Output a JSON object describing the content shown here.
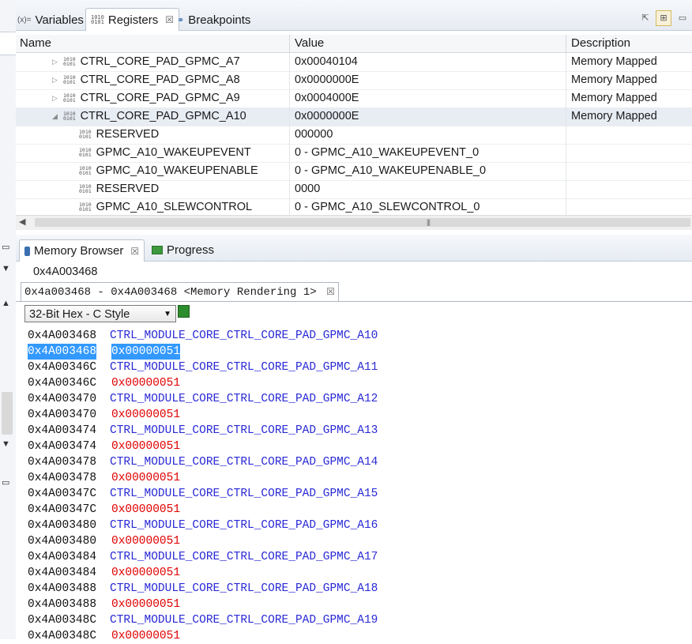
{
  "top_tabs": [
    {
      "label": "Variables",
      "icon": "(x)="
    },
    {
      "label": "Registers",
      "icon": "1010\n0101"
    },
    {
      "label": "Breakpoints",
      "icon": "oo"
    }
  ],
  "registers": {
    "columns": [
      "Name",
      "Value",
      "Description"
    ],
    "rows": [
      {
        "name": "CTRL_CORE_PAD_GPMC_A7",
        "value": "0x00040104",
        "desc": "Memory Mapped",
        "expanded": false
      },
      {
        "name": "CTRL_CORE_PAD_GPMC_A8",
        "value": "0x0000000E",
        "desc": "Memory Mapped",
        "expanded": false
      },
      {
        "name": "CTRL_CORE_PAD_GPMC_A9",
        "value": "0x0004000E",
        "desc": "Memory Mapped",
        "expanded": false
      },
      {
        "name": "CTRL_CORE_PAD_GPMC_A10",
        "value": "0x0000000E",
        "desc": "Memory Mapped",
        "expanded": true
      },
      {
        "name": "RESERVED",
        "value": "000000",
        "desc": ""
      },
      {
        "name": "GPMC_A10_WAKEUPEVENT",
        "value": "0 - GPMC_A10_WAKEUPEVENT_0",
        "desc": ""
      },
      {
        "name": "GPMC_A10_WAKEUPENABLE",
        "value": "0 - GPMC_A10_WAKEUPENABLE_0",
        "desc": ""
      },
      {
        "name": "RESERVED",
        "value": "0000",
        "desc": ""
      },
      {
        "name": "GPMC_A10_SLEWCONTROL",
        "value": "0 - GPMC_A10_SLEWCONTROL_0",
        "desc": ""
      }
    ]
  },
  "memory_tabs": [
    {
      "label": "Memory Browser"
    },
    {
      "label": "Progress"
    }
  ],
  "memory": {
    "address_input": "0x4A003468",
    "rendering_tab": "0x4a003468 -  0x4A003468 <Memory Rendering 1>",
    "format": "32-Bit Hex - C Style",
    "rows": [
      {
        "addr": "0x4A003468",
        "val": "CTRL_MODULE_CORE_CTRL_CORE_PAD_GPMC_A10",
        "kind": "label"
      },
      {
        "addr": "0x4A003468",
        "val": "0x00000051",
        "kind": "selected"
      },
      {
        "addr": "0x4A00346C",
        "val": "CTRL_MODULE_CORE_CTRL_CORE_PAD_GPMC_A11",
        "kind": "label"
      },
      {
        "addr": "0x4A00346C",
        "val": "0x00000051",
        "kind": "value"
      },
      {
        "addr": "0x4A003470",
        "val": "CTRL_MODULE_CORE_CTRL_CORE_PAD_GPMC_A12",
        "kind": "label"
      },
      {
        "addr": "0x4A003470",
        "val": "0x00000051",
        "kind": "value"
      },
      {
        "addr": "0x4A003474",
        "val": "CTRL_MODULE_CORE_CTRL_CORE_PAD_GPMC_A13",
        "kind": "label"
      },
      {
        "addr": "0x4A003474",
        "val": "0x00000051",
        "kind": "value"
      },
      {
        "addr": "0x4A003478",
        "val": "CTRL_MODULE_CORE_CTRL_CORE_PAD_GPMC_A14",
        "kind": "label"
      },
      {
        "addr": "0x4A003478",
        "val": "0x00000051",
        "kind": "value"
      },
      {
        "addr": "0x4A00347C",
        "val": "CTRL_MODULE_CORE_CTRL_CORE_PAD_GPMC_A15",
        "kind": "label"
      },
      {
        "addr": "0x4A00347C",
        "val": "0x00000051",
        "kind": "value"
      },
      {
        "addr": "0x4A003480",
        "val": "CTRL_MODULE_CORE_CTRL_CORE_PAD_GPMC_A16",
        "kind": "label"
      },
      {
        "addr": "0x4A003480",
        "val": "0x00000051",
        "kind": "value"
      },
      {
        "addr": "0x4A003484",
        "val": "CTRL_MODULE_CORE_CTRL_CORE_PAD_GPMC_A17",
        "kind": "label"
      },
      {
        "addr": "0x4A003484",
        "val": "0x00000051",
        "kind": "value"
      },
      {
        "addr": "0x4A003488",
        "val": "CTRL_MODULE_CORE_CTRL_CORE_PAD_GPMC_A18",
        "kind": "label"
      },
      {
        "addr": "0x4A003488",
        "val": "0x00000051",
        "kind": "value"
      },
      {
        "addr": "0x4A00348C",
        "val": "CTRL_MODULE_CORE_CTRL_CORE_PAD_GPMC_A19",
        "kind": "label"
      },
      {
        "addr": "0x4A00348C",
        "val": "0x00000051",
        "kind": "value"
      }
    ]
  },
  "colors": {
    "label": "#2a2ad6",
    "value": "#e00000",
    "selection": "#3399ff"
  }
}
